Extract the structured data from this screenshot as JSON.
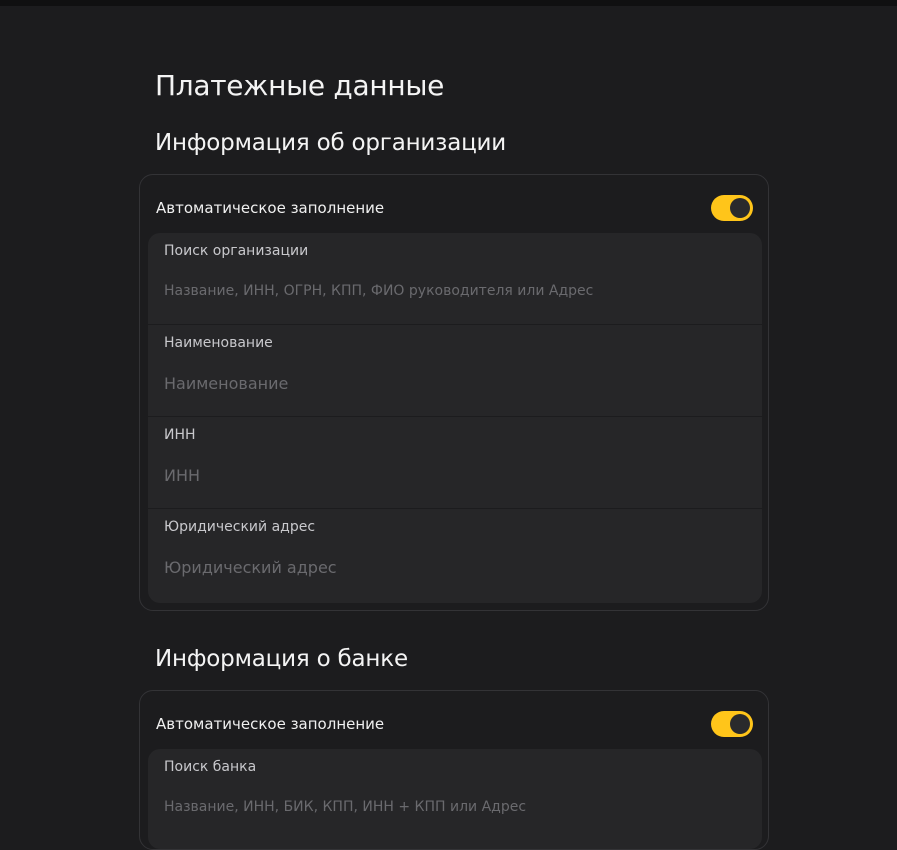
{
  "page": {
    "title": "Платежные данные"
  },
  "organization": {
    "section_title": "Информация об организации",
    "auto_fill_label": "Автоматическое заполнение",
    "auto_fill_enabled": true,
    "fields": [
      {
        "label": "Поиск организации",
        "value": "",
        "placeholder": "Название, ИНН, ОГРН, КПП, ФИО руководителя или Адрес"
      },
      {
        "label": "Наименование",
        "value": "",
        "placeholder": "Наименование"
      },
      {
        "label": "ИНН",
        "value": "",
        "placeholder": "ИНН"
      },
      {
        "label": "Юридический адрес",
        "value": "",
        "placeholder": "Юридический адрес"
      }
    ]
  },
  "bank": {
    "section_title": "Информация о банке",
    "auto_fill_label": "Автоматическое заполнение",
    "auto_fill_enabled": true,
    "fields": [
      {
        "label": "Поиск банка",
        "value": "",
        "placeholder": "Название, ИНН, БИК, КПП, ИНН + КПП или Адрес"
      }
    ]
  },
  "colors": {
    "background": "#1c1c1e",
    "field_background": "#262628",
    "toggle_on": "#ffc51a",
    "card_border": "#333336"
  }
}
